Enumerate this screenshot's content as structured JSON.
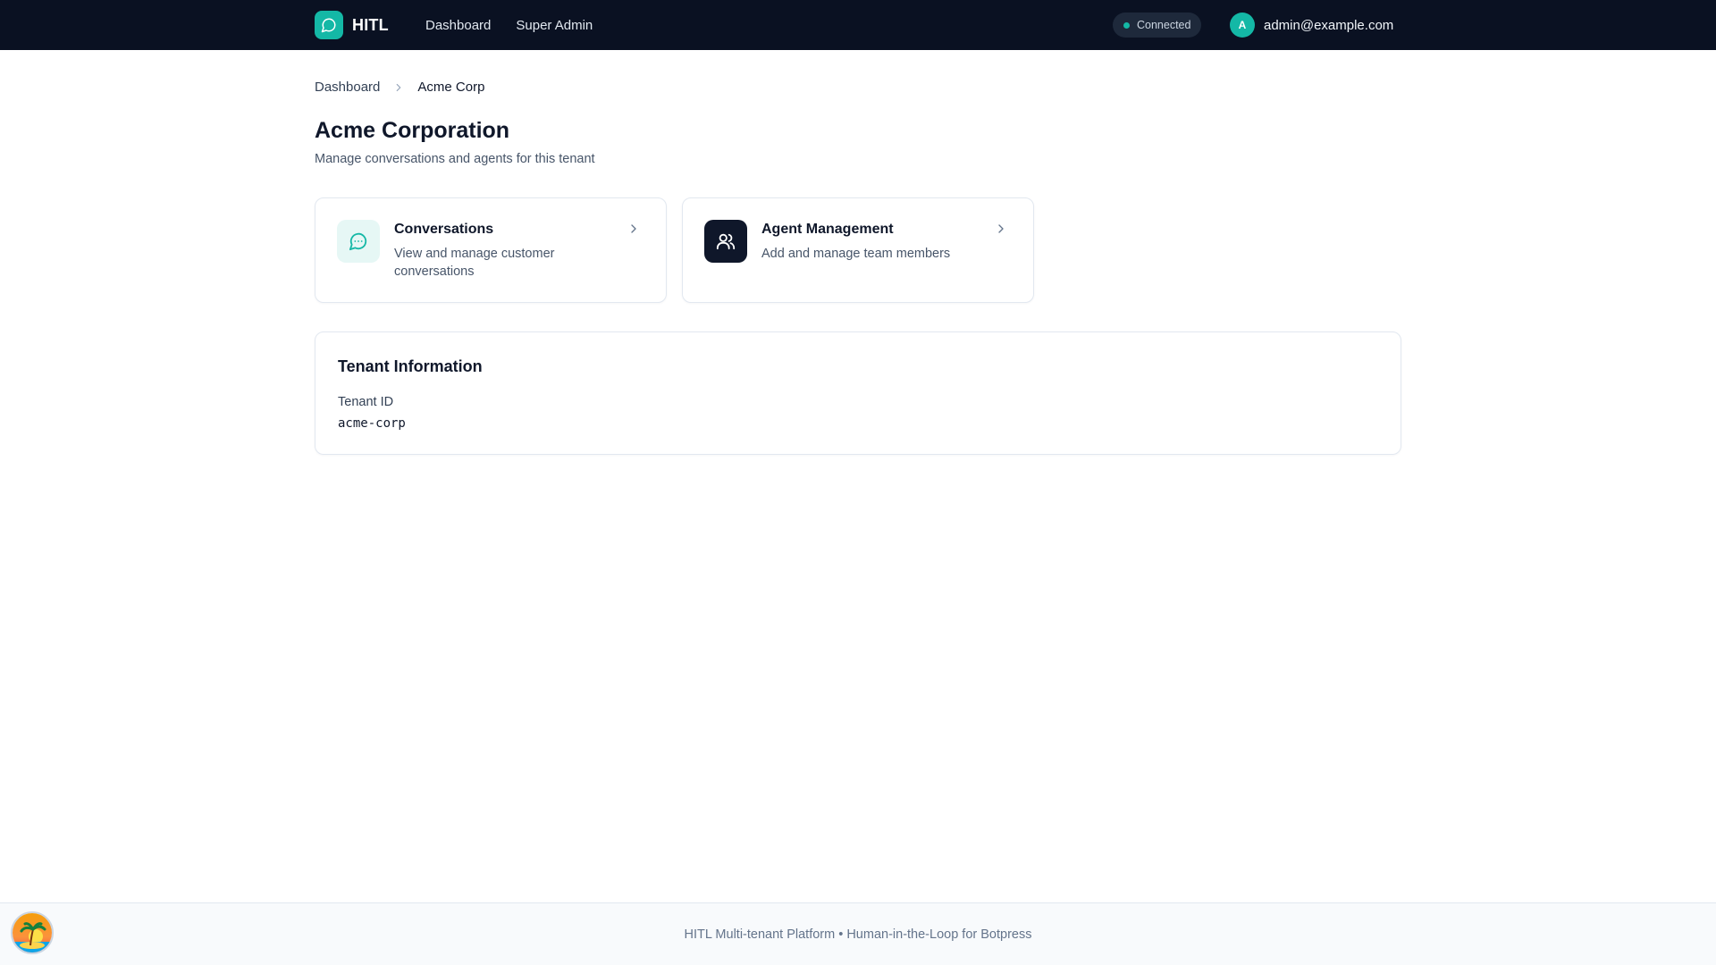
{
  "header": {
    "brand": "HITL",
    "nav": [
      {
        "label": "Dashboard"
      },
      {
        "label": "Super Admin"
      }
    ],
    "status": "Connected",
    "user": {
      "initial": "A",
      "email": "admin@example.com"
    }
  },
  "breadcrumb": {
    "items": [
      "Dashboard",
      "Acme Corp"
    ]
  },
  "page": {
    "title": "Acme Corporation",
    "subtitle": "Manage conversations and agents for this tenant"
  },
  "cards": [
    {
      "title": "Conversations",
      "description": "View and manage customer conversations",
      "icon": "chat-icon"
    },
    {
      "title": "Agent Management",
      "description": "Add and manage team members",
      "icon": "users-icon"
    }
  ],
  "tenant_info": {
    "title": "Tenant Information",
    "label": "Tenant ID",
    "value": "acme-corp"
  },
  "footer": {
    "text": "HITL Multi-tenant Platform • Human-in-the-Loop for Botpress"
  },
  "colors": {
    "accent": "#14b8a6",
    "topbar": "#0a1122",
    "dark_icon_bg": "#0f172a"
  }
}
